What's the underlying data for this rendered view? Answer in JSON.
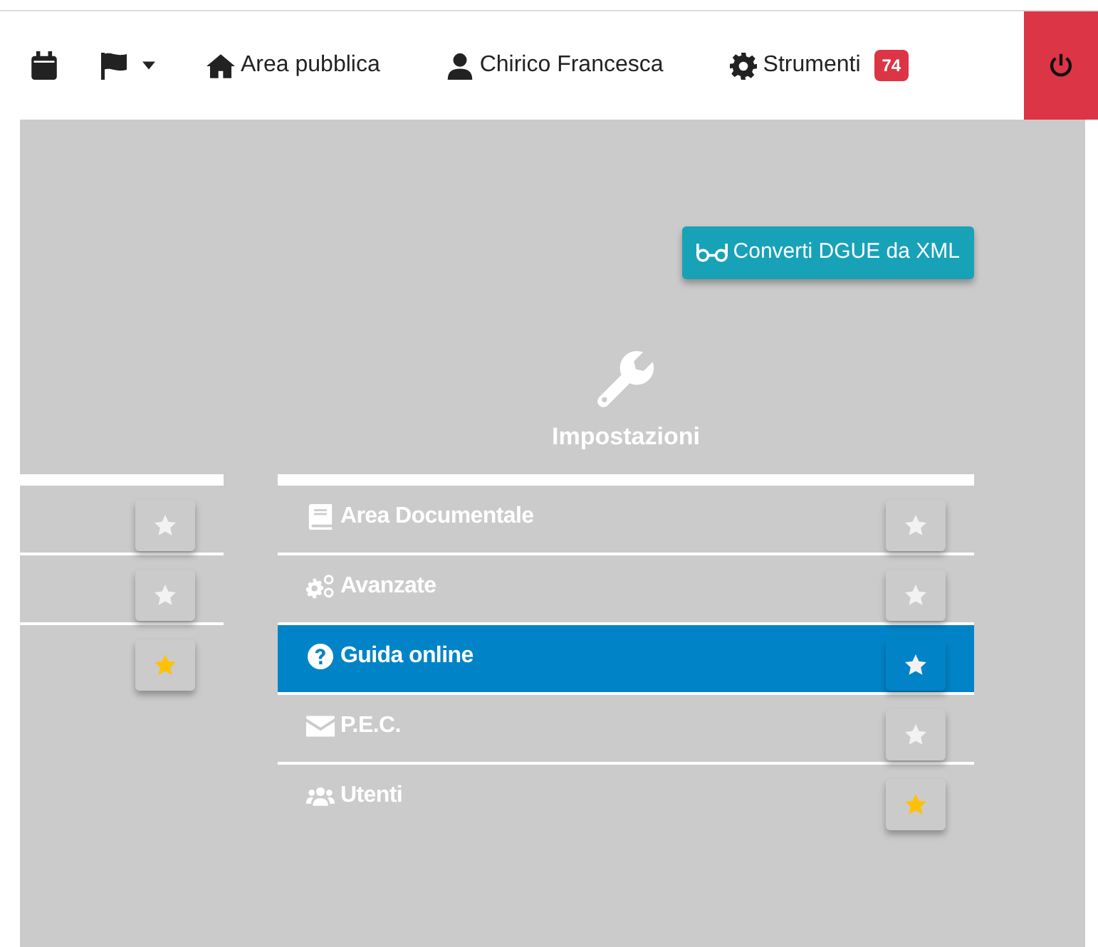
{
  "navbar": {
    "links": [
      {
        "label": "Area pubblica"
      },
      {
        "label": "Chirico Francesca"
      },
      {
        "label": "Strumenti",
        "badge": "74"
      }
    ]
  },
  "convert_button": {
    "label": "Converti DGUE da XML"
  },
  "left_section": {
    "items": [
      {
        "favorite": false
      },
      {
        "favorite": false
      },
      {
        "favorite": true
      }
    ]
  },
  "settings_section": {
    "title": "Impostazioni",
    "items": [
      {
        "label": "Area Documentale",
        "selected": false,
        "favorite": false
      },
      {
        "label": "Avanzate",
        "selected": false,
        "favorite": false
      },
      {
        "label": "Guida online",
        "selected": true,
        "favorite": false
      },
      {
        "label": "P.E.C.",
        "selected": false,
        "favorite": false
      },
      {
        "label": "Utenti",
        "selected": false,
        "favorite": true
      }
    ]
  }
}
